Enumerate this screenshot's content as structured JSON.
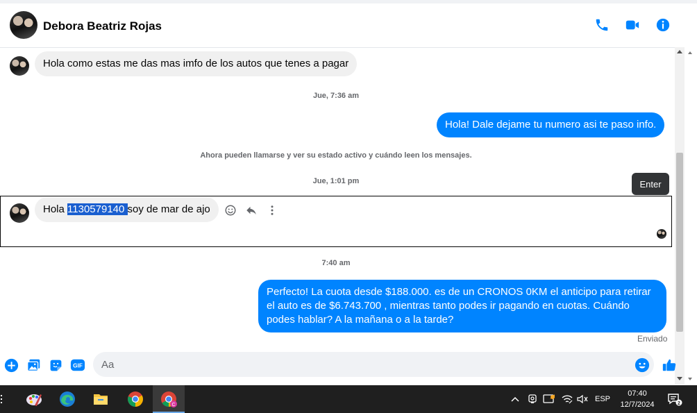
{
  "header": {
    "contact_name": "Debora Beatriz Rojas",
    "icons": [
      "phone-icon",
      "video-icon",
      "info-icon"
    ],
    "accent_color": "#0084ff"
  },
  "messages": {
    "m1": {
      "text": "Hola como estas me das  mas imfo de los autos que tenes a pagar"
    },
    "ts1": "Jue, 7:36 am",
    "m2": {
      "text": "Hola! Dale dejame tu numero  asi te paso info."
    },
    "system_note": "Ahora pueden llamarse y ver su estado activo y cuándo leen los mensajes.",
    "ts2": "Jue, 1:01 pm",
    "m3": {
      "prefix": "Hola ",
      "selected": "1130579140 ",
      "suffix": "soy de mar de ajo"
    },
    "tooltip": "Enter",
    "ts3": "7:40 am",
    "m4": {
      "text": "Perfecto! La cuota desde $188.000. es de un CRONOS 0KM el anticipo para retirar el auto es de $6.743.700 , mientras tanto podes ir pagando en cuotas. Cuándo podes hablar? A la mañana o a la tarde?"
    },
    "status": "Enviado"
  },
  "composer": {
    "placeholder": "Aa",
    "icons": [
      "plus-icon",
      "image-icon",
      "sticker-icon",
      "gif-icon",
      "emoji-icon",
      "like-icon"
    ],
    "gif_label": "GIF"
  },
  "taskbar": {
    "apps": [
      "paint-icon",
      "edge-icon",
      "file-explorer-icon",
      "chrome-icon",
      "chrome-profile-icon"
    ],
    "lang": "ESP",
    "time": "07:40",
    "date": "12/7/2024",
    "notif_count": "2"
  }
}
